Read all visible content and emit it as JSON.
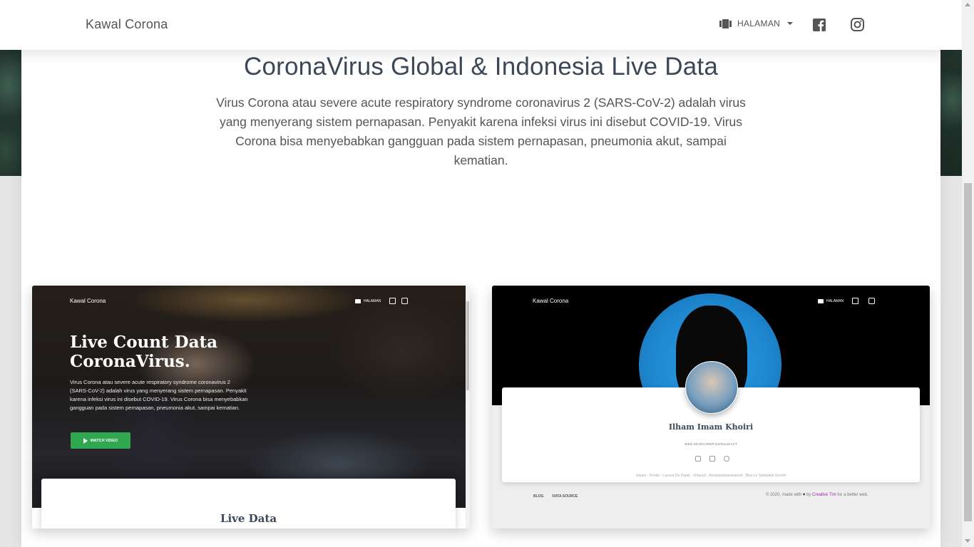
{
  "navbar": {
    "brand": "Kawal Corona",
    "dropdown_label": "HALAMAN",
    "dropdown_icon": "view-carousel-icon",
    "social": [
      "facebook-icon",
      "instagram-icon"
    ]
  },
  "main": {
    "title": "CoronaVirus Global & Indonesia Live Data",
    "description": "Virus Corona atau severe acute respiratory syndrome coronavirus 2 (SARS-CoV-2) adalah virus yang menyerang sistem pernapasan. Penyakit karena infeksi virus ini disebut COVID-19. Virus Corona bisa menyebabkan gangguan pada sistem pernapasan, pneumonia akut, sampai kematian."
  },
  "cards": [
    {
      "brand": "Kawal Corona",
      "nav_label": "HALAMAN",
      "headline_line1": "Live Count Data",
      "headline_line2": "CoronaVirus.",
      "text": "Virus Corona atau severe acute respiratory syndrome coronavirus 2 (SARS-CoV-2) adalah virus yang menyerang sistem pernapasan. Penyakit karena infeksi virus ini disebut COVID-19. Virus Corona bisa menyebabkan gangguan pada sistem pernapasan, pneumonia akut, sampai kematian.",
      "button": "WATCH VIDEO",
      "section_title": "Live Data"
    },
    {
      "brand": "Kawal Corona",
      "nav_label": "HALAMAN",
      "profile_name": "Ilham Imam Khoiri",
      "profile_role": "WEB DEVELOPER ENTHUSIAST",
      "profile_links": "Jokam - Persib - Lacasa De Papel - Shitpost - Awokawokawokawok - Bisa Lo Tambahin Sendiri",
      "footer_links": [
        "BLOG",
        "DATA SOURCE"
      ],
      "footer_copy_prefix": "© 2020, made with",
      "footer_copy_by": "by",
      "footer_copy_author": "Creative Tim",
      "footer_copy_suffix": "for a better web."
    }
  ],
  "colors": {
    "accent_green": "#2fa84f",
    "creative_tim": "#9c27b0",
    "profile_blue": "#1e86cf"
  }
}
